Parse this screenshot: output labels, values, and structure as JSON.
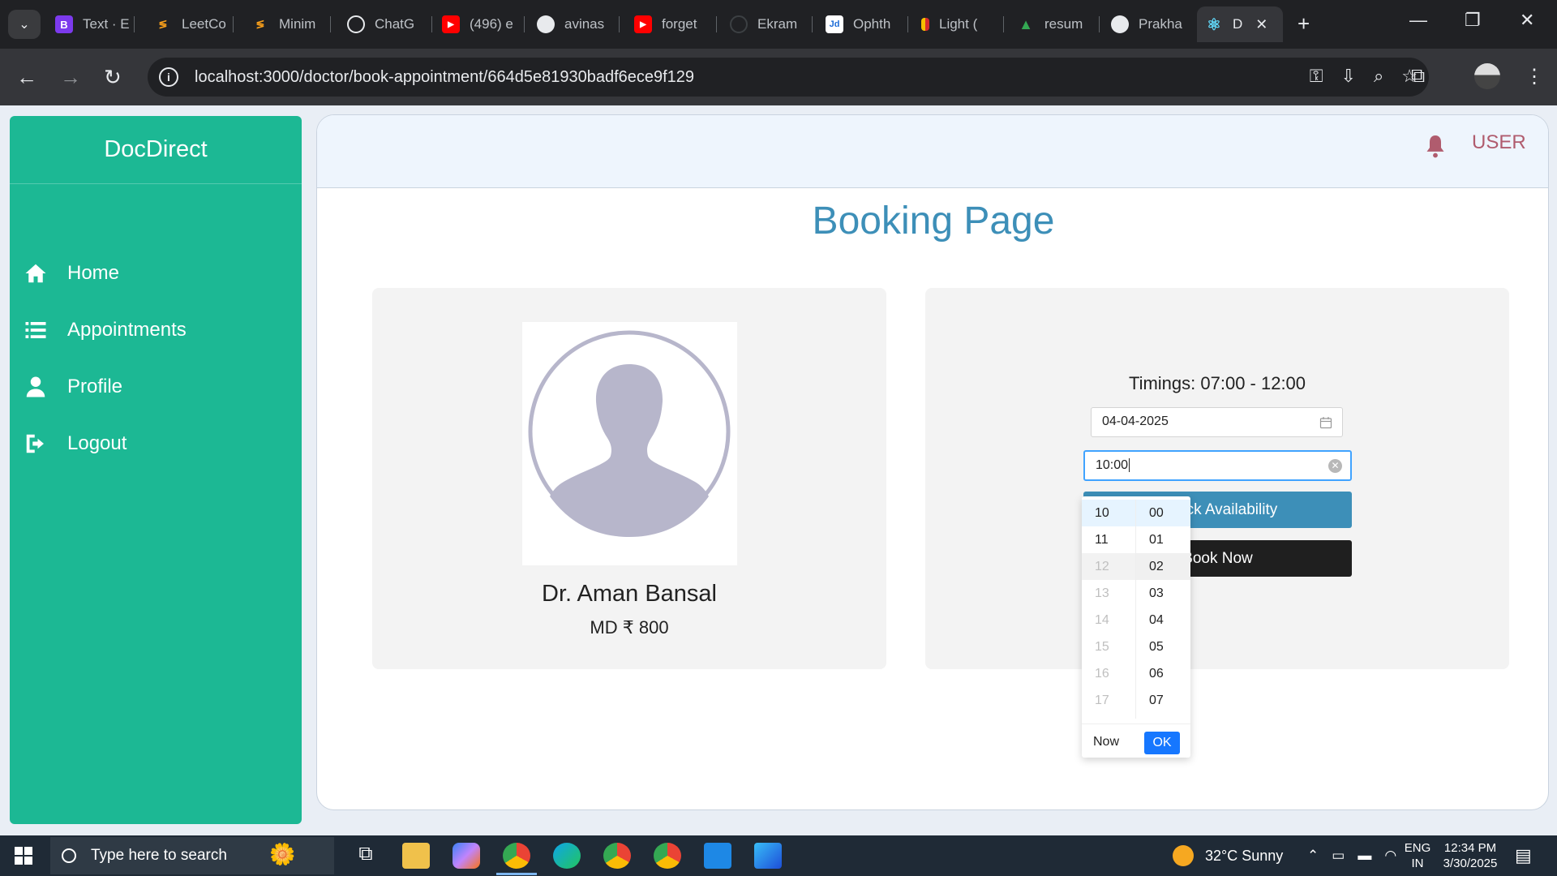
{
  "browser": {
    "tabs": [
      {
        "title": "Text · E",
        "fav_color": "#7c3aed",
        "fav_glyph": "B"
      },
      {
        "title": "LeetCo",
        "fav_color": "#202124",
        "fav_glyph": "≶"
      },
      {
        "title": "Minim",
        "fav_color": "#202124",
        "fav_glyph": "≶"
      },
      {
        "title": "ChatG",
        "fav_color": "#202124",
        "fav_glyph": "◎"
      },
      {
        "title": "(496) e",
        "fav_color": "#ff0000",
        "fav_glyph": "▶"
      },
      {
        "title": "avinas",
        "fav_color": "#202124",
        "fav_glyph": "●"
      },
      {
        "title": "forget",
        "fav_color": "#ff0000",
        "fav_glyph": "▶"
      },
      {
        "title": "Ekram",
        "fav_color": "#202124",
        "fav_glyph": "○"
      },
      {
        "title": "Ophth",
        "fav_color": "#1c6bd6",
        "fav_glyph": "Jd"
      },
      {
        "title": "Light (",
        "fav_color": "#202124",
        "fav_glyph": "▮"
      },
      {
        "title": "resum",
        "fav_color": "#202124",
        "fav_glyph": "▲"
      },
      {
        "title": "Prakha",
        "fav_color": "#202124",
        "fav_glyph": "●"
      }
    ],
    "active_tab": {
      "title": "D",
      "fav_glyph": "⚛"
    },
    "url": "localhost:3000/doctor/book-appointment/664d5e81930badf6ece9f129"
  },
  "sidebar": {
    "brand": "DocDirect",
    "items": [
      {
        "label": "Home",
        "icon": "home-icon"
      },
      {
        "label": "Appointments",
        "icon": "list-icon"
      },
      {
        "label": "Profile",
        "icon": "user-icon"
      },
      {
        "label": "Logout",
        "icon": "logout-icon"
      }
    ]
  },
  "header": {
    "user_label": "USER"
  },
  "page": {
    "title": "Booking Page"
  },
  "doctor": {
    "name": "Dr. Aman Bansal",
    "fee": "MD ₹ 800"
  },
  "booking": {
    "timings": "Timings: 07:00 - 12:00",
    "date_value": "04-04-2025",
    "time_value": "10:00",
    "check_label": "Check Availability",
    "book_label": "Book Now"
  },
  "picker": {
    "hours": [
      "10",
      "11",
      "12",
      "13",
      "14",
      "15",
      "16",
      "17"
    ],
    "minutes": [
      "00",
      "01",
      "02",
      "03",
      "04",
      "05",
      "06",
      "07"
    ],
    "now_label": "Now",
    "ok_label": "OK"
  },
  "taskbar": {
    "search_placeholder": "Type here to search",
    "weather": "32°C  Sunny",
    "lang_line1": "ENG",
    "lang_line2": "IN",
    "time": "12:34 PM",
    "date": "3/30/2025"
  },
  "colors": {
    "sidebar": "#1cb894",
    "title": "#3d8fb8",
    "check_button": "#3d8fb8",
    "book_button": "#1f1f1f",
    "ok_button": "#1677ff"
  }
}
